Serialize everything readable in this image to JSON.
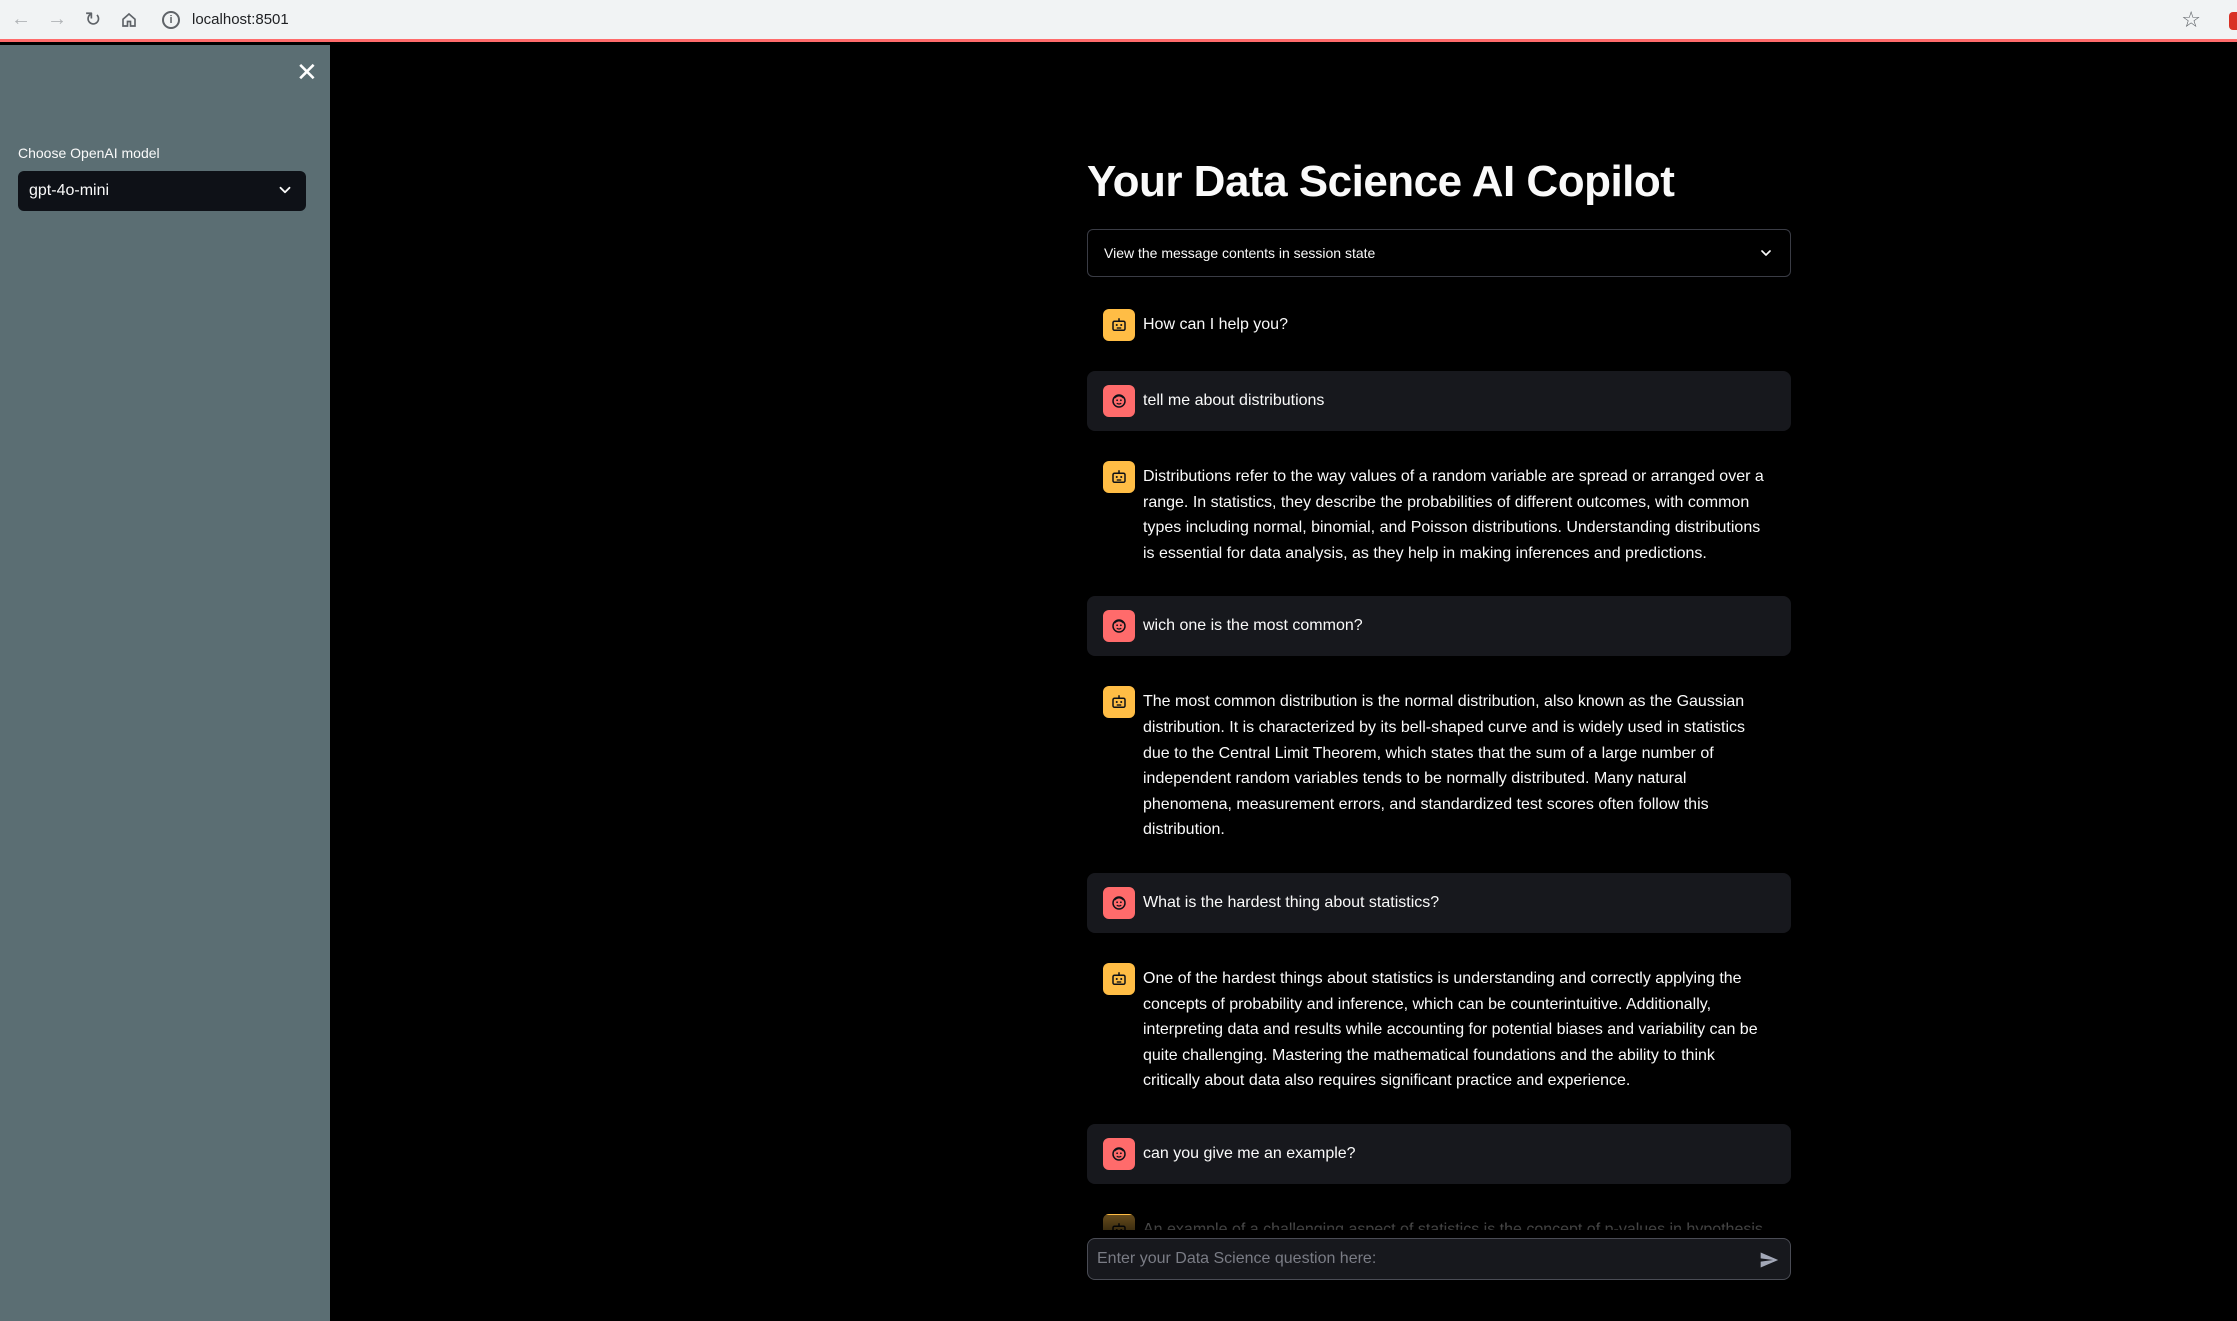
{
  "browser": {
    "url": "localhost:8501"
  },
  "sidebar": {
    "model_label": "Choose OpenAI model",
    "model_value": "gpt-4o-mini"
  },
  "main": {
    "title": "Your Data Science AI Copilot",
    "expander_label": "View the message contents in session state",
    "input_placeholder": "Enter your Data Science question here:"
  },
  "messages": [
    {
      "role": "assistant",
      "text": "How can I help you?"
    },
    {
      "role": "user",
      "text": "tell me about distributions"
    },
    {
      "role": "assistant",
      "text": "Distributions refer to the way values of a random variable are spread or arranged over a range. In statistics, they describe the probabilities of different outcomes, with common types including normal, binomial, and Poisson distributions. Understanding distributions is essential for data analysis, as they help in making inferences and predictions."
    },
    {
      "role": "user",
      "text": "wich one is the most common?"
    },
    {
      "role": "assistant",
      "text": "The most common distribution is the normal distribution, also known as the Gaussian distribution. It is characterized by its bell-shaped curve and is widely used in statistics due to the Central Limit Theorem, which states that the sum of a large number of independent random variables tends to be normally distributed. Many natural phenomena, measurement errors, and standardized test scores often follow this distribution."
    },
    {
      "role": "user",
      "text": "What is the hardest thing about statistics?"
    },
    {
      "role": "assistant",
      "text": "One of the hardest things about statistics is understanding and correctly applying the concepts of probability and inference, which can be counterintuitive. Additionally, interpreting data and results while accounting for potential biases and variability can be quite challenging. Mastering the mathematical foundations and the ability to think critically about data also requires significant practice and experience."
    },
    {
      "role": "user",
      "text": "can you give me an example?"
    },
    {
      "role": "assistant",
      "text": "An example of a challenging aspect of statistics is the concept of p-values in hypothesis testing. A"
    }
  ],
  "colors": {
    "sidebar_bg": "#5b6e73",
    "main_bg": "#000000",
    "assistant_avatar": "#ffbd45",
    "user_avatar": "#ff6b6b",
    "user_msg_bg": "#17181d"
  }
}
